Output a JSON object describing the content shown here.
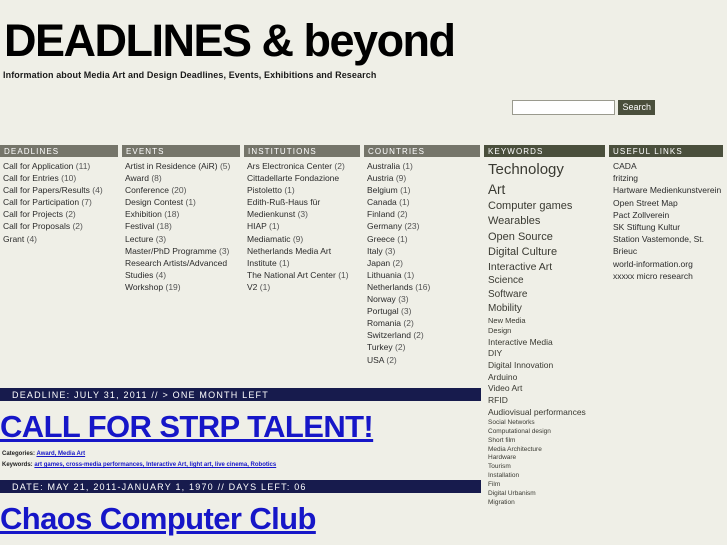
{
  "site": {
    "title": "DEADLINES & beyond",
    "tagline": "Information about Media Art and Design Deadlines, Events, Exhibitions and Research"
  },
  "search": {
    "value": "",
    "placeholder": "",
    "button_label": "Search"
  },
  "colors": {
    "page_background": "#efefe7",
    "column_header_gray": "#75756a",
    "column_header_olive": "#4a4f3c",
    "post_meta_bar": "#171b4d",
    "link_blue": "#1616c8",
    "search_button": "#4a4f3c"
  },
  "columns": [
    {
      "id": "deadlines",
      "header": "DEADLINES",
      "header_style": "gray",
      "items": [
        {
          "label": "Call for Application",
          "count": "(11)"
        },
        {
          "label": "Call for Entries",
          "count": "(10)"
        },
        {
          "label": "Call for Papers/Results",
          "count": "(4)"
        },
        {
          "label": "Call for Participation",
          "count": "(7)"
        },
        {
          "label": "Call for Projects",
          "count": "(2)"
        },
        {
          "label": "Call for Proposals",
          "count": "(2)"
        },
        {
          "label": "Grant",
          "count": "(4)"
        }
      ]
    },
    {
      "id": "events",
      "header": "EVENTS",
      "header_style": "gray",
      "items": [
        {
          "label": "Artist in Residence (AiR)",
          "count": "(5)"
        },
        {
          "label": "Award",
          "count": "(8)"
        },
        {
          "label": "Conference",
          "count": "(20)"
        },
        {
          "label": "Design Contest",
          "count": "(1)"
        },
        {
          "label": "Exhibition",
          "count": "(18)"
        },
        {
          "label": "Festival",
          "count": "(18)"
        },
        {
          "label": "Lecture",
          "count": "(3)"
        },
        {
          "label": "Master/PhD Programme",
          "count": "(3)"
        },
        {
          "label": "Research Artists/Advanced Studies",
          "count": "(4)"
        },
        {
          "label": "Workshop",
          "count": "(19)"
        }
      ]
    },
    {
      "id": "institutions",
      "header": "INSTITUTIONS",
      "header_style": "gray",
      "items": [
        {
          "label": "Ars Electronica Center",
          "count": "(2)"
        },
        {
          "label": "Cittadellarte Fondazione Pistoletto",
          "count": "(1)"
        },
        {
          "label": "Edith-Ruß-Haus für Medienkunst",
          "count": "(3)"
        },
        {
          "label": "HIAP",
          "count": "(1)"
        },
        {
          "label": "Mediamatic",
          "count": "(9)"
        },
        {
          "label": "Netherlands Media Art Institute",
          "count": "(1)"
        },
        {
          "label": "The National Art Center",
          "count": "(1)"
        },
        {
          "label": "V2",
          "count": "(1)"
        }
      ]
    },
    {
      "id": "countries",
      "header": "COUNTRIES",
      "header_style": "gray",
      "items": [
        {
          "label": "Australia",
          "count": "(1)"
        },
        {
          "label": "Austria",
          "count": "(9)"
        },
        {
          "label": "Belgium",
          "count": "(1)"
        },
        {
          "label": "Canada",
          "count": "(1)"
        },
        {
          "label": "Finland",
          "count": "(2)"
        },
        {
          "label": "Germany",
          "count": "(23)"
        },
        {
          "label": "Greece",
          "count": "(1)"
        },
        {
          "label": "Italy",
          "count": "(3)"
        },
        {
          "label": "Japan",
          "count": "(2)"
        },
        {
          "label": "Lithuania",
          "count": "(1)"
        },
        {
          "label": "Netherlands",
          "count": "(16)"
        },
        {
          "label": "Norway",
          "count": "(3)"
        },
        {
          "label": "Portugal",
          "count": "(3)"
        },
        {
          "label": "Romania",
          "count": "(2)"
        },
        {
          "label": "Switzerland",
          "count": "(2)"
        },
        {
          "label": "Turkey",
          "count": "(2)"
        },
        {
          "label": "USA",
          "count": "(2)"
        }
      ]
    }
  ],
  "keywords": {
    "header": "KEYWORDS",
    "header_style": "olive",
    "tags": [
      {
        "label": "Technology",
        "size": 15
      },
      {
        "label": "Art",
        "size": 13.5
      },
      {
        "label": "Computer games",
        "size": 11
      },
      {
        "label": "Wearables",
        "size": 11
      },
      {
        "label": "Open Source",
        "size": 11
      },
      {
        "label": "Digital Culture",
        "size": 11
      },
      {
        "label": "Interactive Art",
        "size": 10.5
      },
      {
        "label": "Science",
        "size": 10
      },
      {
        "label": "Software",
        "size": 10
      },
      {
        "label": "Mobility",
        "size": 10
      },
      {
        "label": "New Media",
        "size": 7.5
      },
      {
        "label": "Design",
        "size": 7.5
      },
      {
        "label": "Interactive Media",
        "size": 8.5
      },
      {
        "label": "DIY",
        "size": 8.5
      },
      {
        "label": "Digital Innovation",
        "size": 8.5
      },
      {
        "label": "Arduino",
        "size": 8.5
      },
      {
        "label": "Video Art",
        "size": 8.5
      },
      {
        "label": "RFID",
        "size": 8.5
      },
      {
        "label": "Audiovisual performances",
        "size": 8.5
      },
      {
        "label": "Social Networks",
        "size": 6.5
      },
      {
        "label": "Computational design",
        "size": 6.5
      },
      {
        "label": "Short film",
        "size": 6.5
      },
      {
        "label": "Media Architecture",
        "size": 6.5
      },
      {
        "label": "Hardware",
        "size": 6.5
      },
      {
        "label": "Tourism",
        "size": 6.5
      },
      {
        "label": "Installation",
        "size": 6.5
      },
      {
        "label": "Film",
        "size": 6.5
      },
      {
        "label": "Digital Urbanism",
        "size": 6.5
      },
      {
        "label": "Migration",
        "size": 6.5
      }
    ]
  },
  "useful_links": {
    "header": "USEFUL LINKS",
    "header_style": "olive",
    "items": [
      "CADA",
      "fritzing",
      "Hartware Medienkunstverein",
      "Open Street Map",
      "Pact Zollverein",
      "SK Stiftung Kultur",
      "Station Vastemonde, St. Brieuc",
      "world-information.org",
      "xxxxx micro research"
    ]
  },
  "posts": [
    {
      "meta": "DEADLINE: JULY 31, 2011 // > ONE MONTH LEFT",
      "title": "CALL FOR STRP TALENT!",
      "categories_label": "Categories:",
      "categories": "Award, Media Art",
      "keywords_label": "Keywords:",
      "keywords": "art games, cross-media performances, Interactive Art, light art, live cinema, Robotics"
    },
    {
      "meta": "DATE: MAY 21, 2011-JANUARY 1, 1970 // DAYS LEFT: 06",
      "title": "Chaos Computer Club",
      "categories_label": "",
      "categories": "",
      "keywords_label": "",
      "keywords": ""
    }
  ]
}
